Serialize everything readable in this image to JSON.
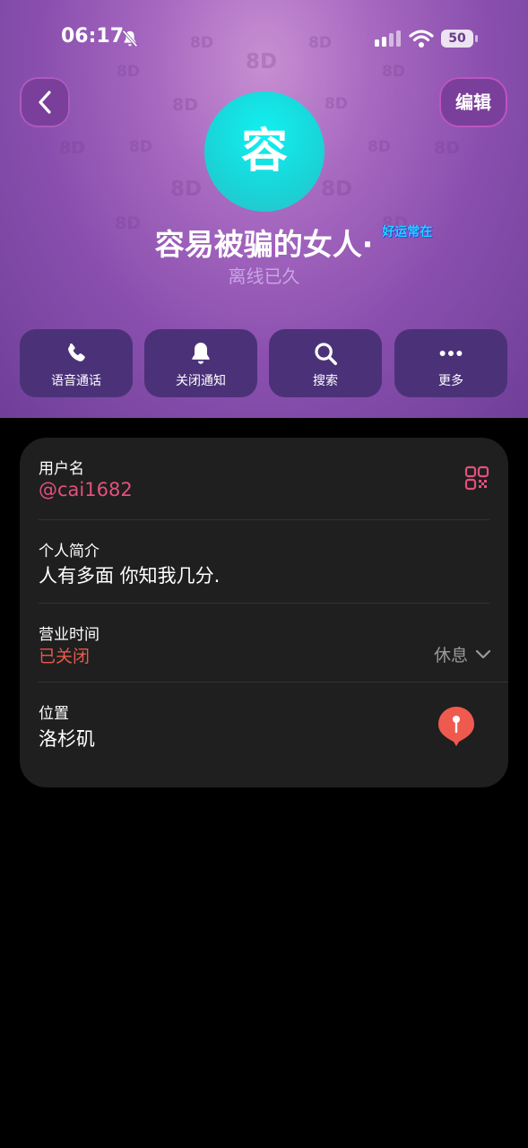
{
  "status_bar": {
    "time": "06:17",
    "battery": "50"
  },
  "header": {
    "edit_label": "编辑",
    "avatar_char": "容",
    "name": "容易被骗的女人·",
    "name_badge": "好运常在",
    "status": "离线已久",
    "pattern_text": "8D"
  },
  "actions": [
    {
      "label": "语音通话",
      "icon": "phone-icon"
    },
    {
      "label": "关闭通知",
      "icon": "bell-icon"
    },
    {
      "label": "搜索",
      "icon": "search-icon"
    },
    {
      "label": "更多",
      "icon": "more-icon"
    }
  ],
  "info": {
    "username_label": "用户名",
    "username": "@cai1682",
    "bio_label": "个人简介",
    "bio": "人有多面 你知我几分.",
    "hours_label": "营业时间",
    "hours_status": "已关闭",
    "hours_rest": "休息",
    "location_label": "位置",
    "location": "洛杉矶"
  },
  "colors": {
    "accent_pink": "#e4507e",
    "closed_red": "#e85a4a",
    "pin_red": "#ef5a4f",
    "avatar_cyan": "#19d4d8",
    "action_bg": "#4b3278"
  }
}
